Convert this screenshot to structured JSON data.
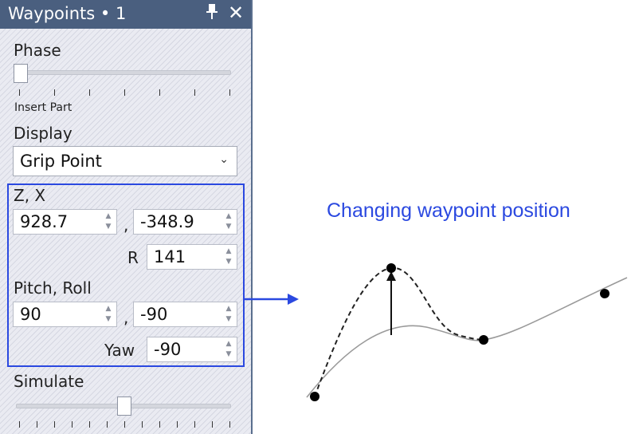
{
  "window": {
    "title": "Waypoints • 1",
    "pin_icon": "pin-icon",
    "close_icon": "close-icon"
  },
  "phase": {
    "label": "Phase",
    "value_label": "Insert Part",
    "position": 0
  },
  "display": {
    "label": "Display",
    "selected": "Grip Point",
    "chevron_icon": "chevron-down-icon"
  },
  "coords": {
    "zx_label": "Z, X",
    "z": "928.7",
    "x": "-348.9",
    "r_label": "R",
    "r": "141",
    "pitch_roll_label": "Pitch, Roll",
    "pitch": "90",
    "roll": "-90",
    "yaw_label": "Yaw",
    "yaw": "-90",
    "separator": ","
  },
  "simulate": {
    "label": "Simulate",
    "position": 0.5
  },
  "annotation": {
    "caption": "Changing waypoint position",
    "highlight_color": "#2b49e0"
  },
  "spin_glyphs": {
    "up": "▲",
    "down": "▼"
  }
}
